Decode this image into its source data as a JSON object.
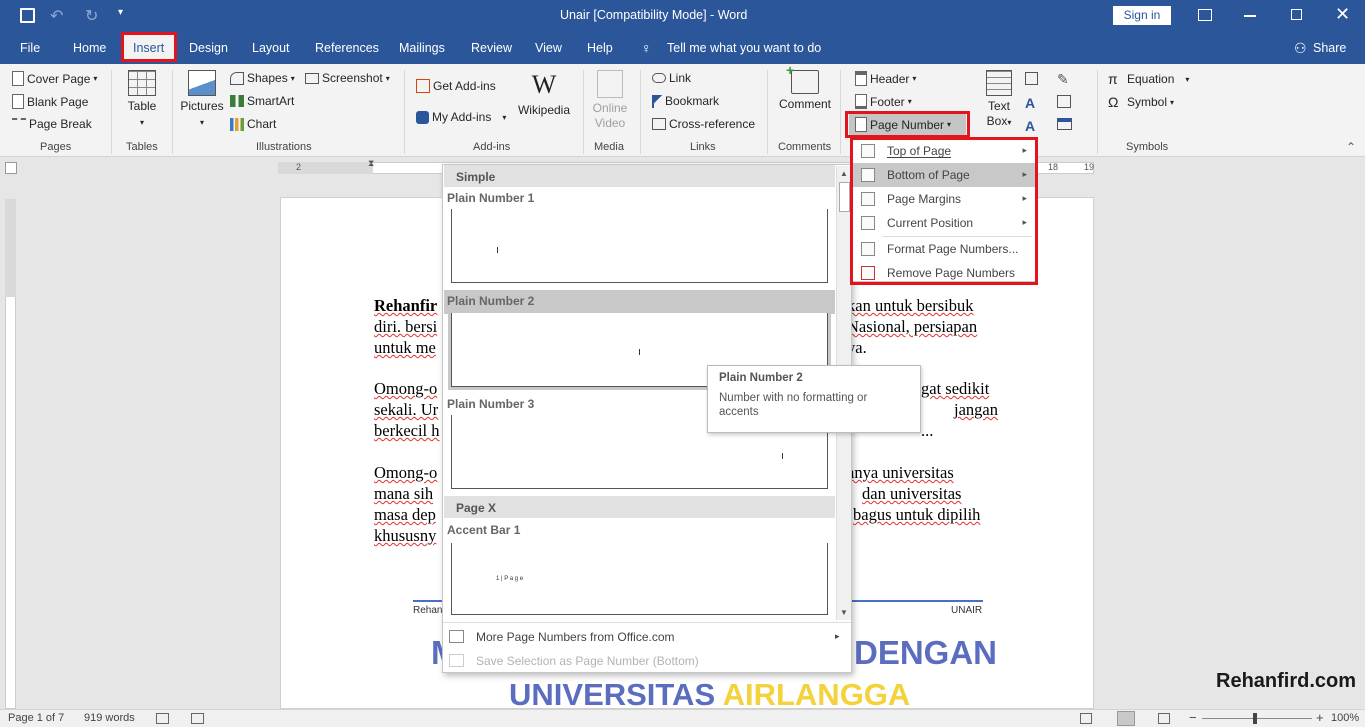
{
  "title_bar": {
    "title": "Unair [Compatibility Mode]  -  Word",
    "sign_in": "Sign in"
  },
  "tabs": [
    "File",
    "Home",
    "Insert",
    "Design",
    "Layout",
    "References",
    "Mailings",
    "Review",
    "View",
    "Help"
  ],
  "tell_me": "Tell me what you want to do",
  "share": "Share",
  "ribbon": {
    "pages": {
      "cover_page": "Cover Page",
      "blank_page": "Blank Page",
      "page_break": "Page Break",
      "group": "Pages"
    },
    "tables": {
      "table": "Table",
      "group": "Tables"
    },
    "illustrations": {
      "pictures": "Pictures",
      "shapes": "Shapes",
      "screenshot": "Screenshot",
      "smartart": "SmartArt",
      "chart": "Chart",
      "group": "Illustrations"
    },
    "addins": {
      "get_addins": "Get Add-ins",
      "my_addins": "My Add-ins",
      "wikipedia": "Wikipedia",
      "group": "Add-ins"
    },
    "media": {
      "online_video_1": "Online",
      "online_video_2": "Video",
      "group": "Media"
    },
    "links": {
      "link": "Link",
      "bookmark": "Bookmark",
      "cross_reference": "Cross-reference",
      "group": "Links"
    },
    "comments": {
      "comment": "Comment",
      "group": "Comments"
    },
    "header_footer": {
      "header": "Header",
      "footer": "Footer",
      "page_number": "Page Number"
    },
    "text": {
      "text_box_1": "Text",
      "text_box_2": "Box"
    },
    "symbols": {
      "equation": "Equation",
      "symbol": "Symbol",
      "group": "Symbols"
    }
  },
  "ruler": {
    "h_left": "2",
    "h_right": "18",
    "h_right2": "19"
  },
  "page_number_menu": [
    {
      "label": "Top of Page",
      "arrow": "▸"
    },
    {
      "label": "Bottom of Page",
      "arrow": "▸"
    },
    {
      "label": "Page Margins",
      "arrow": "▸"
    },
    {
      "label": "Current Position",
      "arrow": "▸"
    },
    {
      "label": "Format Page Numbers..."
    },
    {
      "label": "Remove Page Numbers"
    }
  ],
  "gallery": {
    "section_simple": "Simple",
    "plain1": "Plain Number 1",
    "plain2": "Plain Number 2",
    "plain3": "Plain Number 3",
    "section_pagex": "Page X",
    "accent1": "Accent Bar 1",
    "accent_sample": "1 | P a g e",
    "more": "More Page Numbers from Office.com",
    "save_selection": "Save Selection as Page Number (Bottom)"
  },
  "tooltip": {
    "title": "Plain Number 2",
    "desc": "Number with no formatting or accents"
  },
  "document": {
    "lines": [
      {
        "a": "Rehanfir",
        "b": "kan untuk bersibuk"
      },
      {
        "a": "diri. bersi",
        "b": "Nasional, persiapan"
      },
      {
        "a": "untuk me",
        "b": "ya."
      },
      {
        "a": "Omong-o",
        "b": "gat sedikit"
      },
      {
        "a": "sekali. Ur",
        "b": "jangan"
      },
      {
        "a": "berkecil h",
        "b": "..."
      },
      {
        "a": "Omong-o",
        "b": "anya universitas"
      },
      {
        "a": "mana sih",
        "b": "dan universitas"
      },
      {
        "a": "masa dep",
        "b": "bagus untuk dipilih"
      },
      {
        "a": "khususny",
        "b": ""
      }
    ],
    "footer_left": "Rehan",
    "footer_right": "UNAIR",
    "banner1_left": "M",
    "banner1_right": "DENGAN",
    "banner2_a": "UNIVERSITAS",
    "banner2_b": "AIRLANGGA"
  },
  "status": {
    "page": "Page 1 of 7",
    "words": "919 words",
    "zoom": "100%"
  },
  "watermark": "Rehanfird.com",
  "colors": {
    "word_blue": "#2b579a",
    "highlight_red": "#e2141e",
    "banner_blue": "#5b6dbf",
    "banner_yellow": "#f3d23c"
  }
}
